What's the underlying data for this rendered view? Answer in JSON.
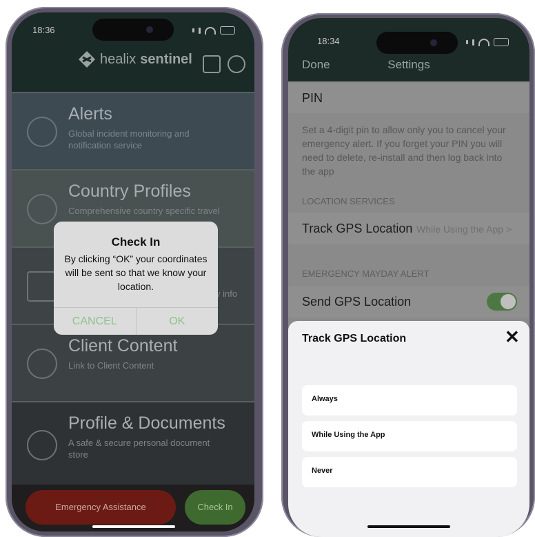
{
  "left": {
    "time": "18:36",
    "brand": {
      "light": "healix",
      "bold": "sentinel"
    },
    "tiles": [
      {
        "title": "Alerts",
        "sub": "Global incident monitoring and notification service"
      },
      {
        "title": "Country Profiles",
        "sub": "Comprehensive country specific travel"
      },
      {
        "title": "",
        "sub": "y info"
      },
      {
        "title": "Client Content",
        "sub": "Link to Client Content"
      },
      {
        "title": "Profile & Documents",
        "sub": "A safe & secure personal document store"
      }
    ],
    "dialog": {
      "title": "Check In",
      "message": "By clicking “OK” your coordinates will be sent so that we know your location.",
      "cancel": "CANCEL",
      "ok": "OK"
    },
    "emergency": "Emergency Assistance",
    "checkin": "Check In"
  },
  "right": {
    "time": "18:34",
    "nav": {
      "done": "Done",
      "title": "Settings"
    },
    "pin": {
      "label": "PIN",
      "desc": "Set a 4-digit pin to allow only you to cancel your emergency alert. If you forget your PIN you will need to delete, re-install and then log back into the app"
    },
    "location_group": "LOCATION SERVICES",
    "track": {
      "label": "Track GPS Location",
      "value": "While Using the App >"
    },
    "mayday_group": "EMERGENCY MAYDAY ALERT",
    "send": {
      "label": "Send GPS Location",
      "toggle_on": true
    },
    "sheet": {
      "title": "Track GPS Location",
      "close": "✕",
      "options": [
        "Always",
        "While Using the App",
        "Never"
      ]
    }
  }
}
